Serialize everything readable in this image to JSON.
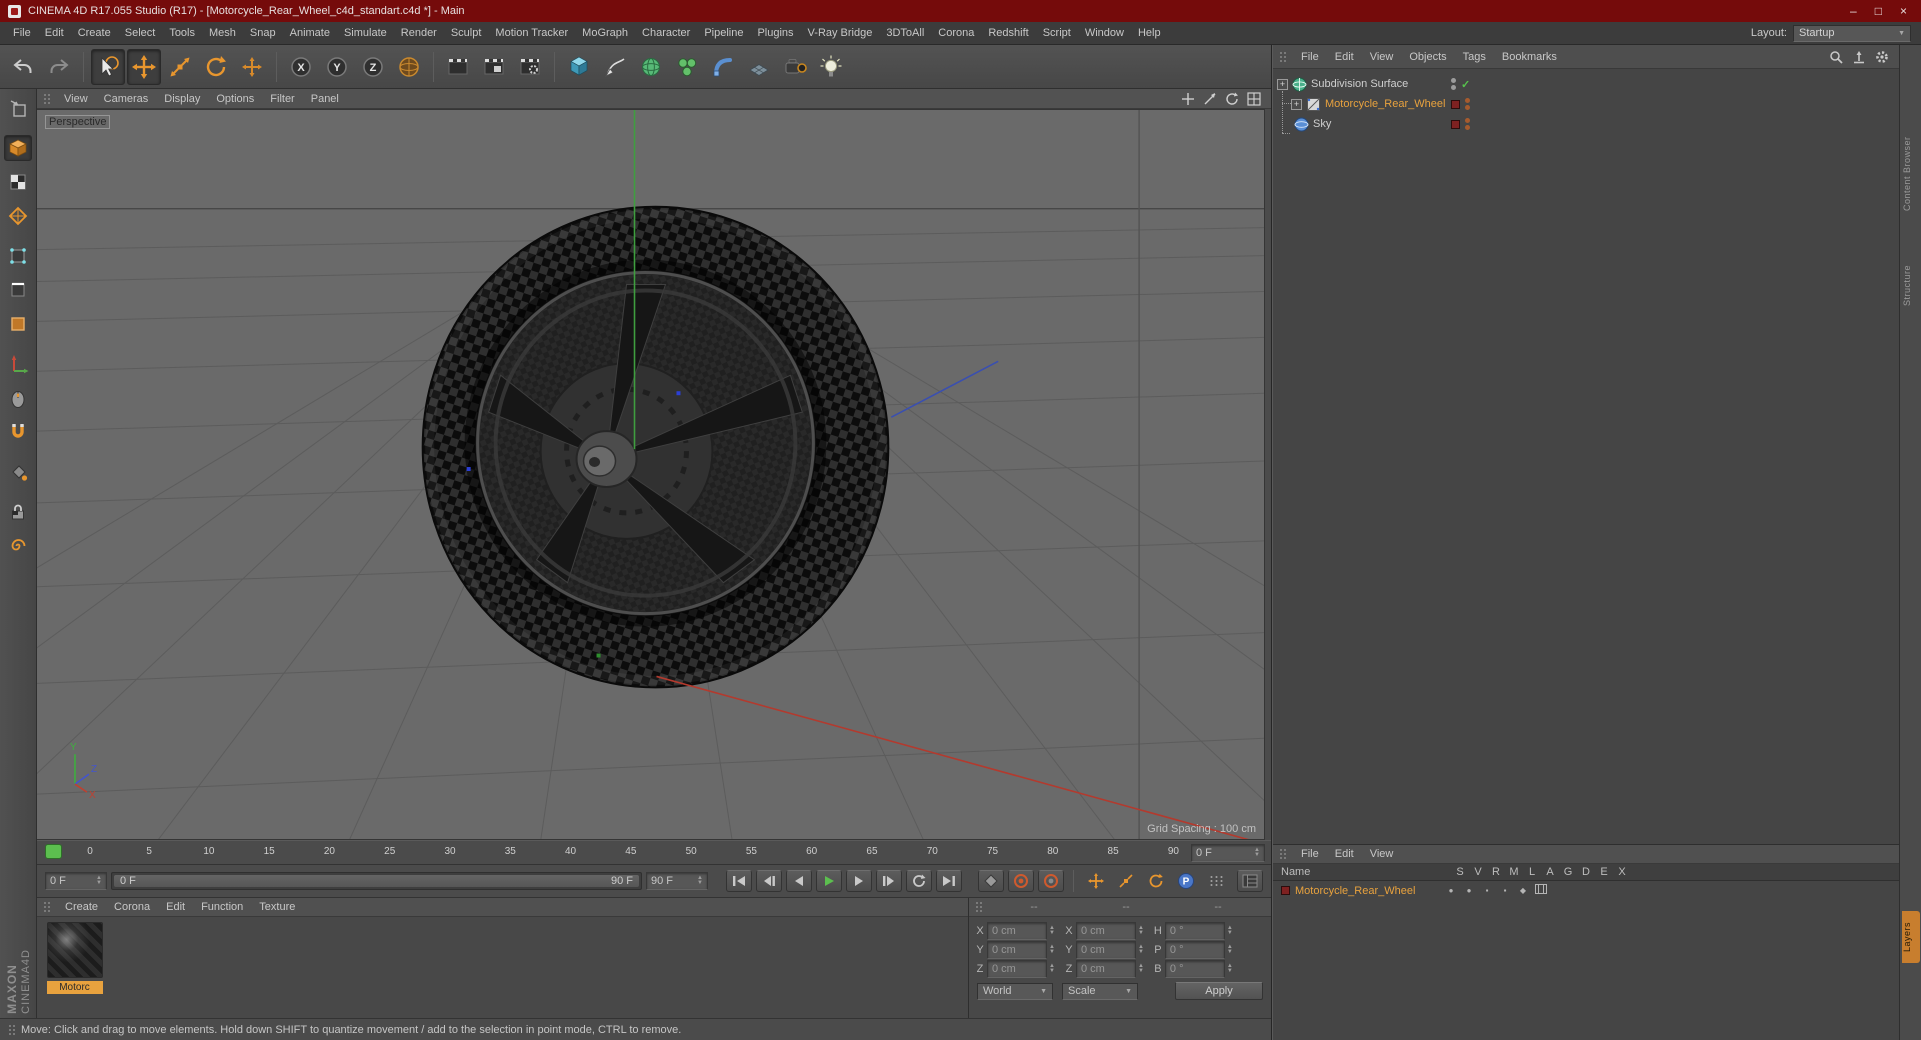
{
  "window": {
    "title": "CINEMA 4D R17.055 Studio (R17) - [Motorcycle_Rear_Wheel_c4d_standart.c4d *] - Main",
    "controls": {
      "min": "–",
      "max": "□",
      "close": "×"
    }
  },
  "menubar": {
    "items": [
      "File",
      "Edit",
      "Create",
      "Select",
      "Tools",
      "Mesh",
      "Snap",
      "Animate",
      "Simulate",
      "Render",
      "Sculpt",
      "Motion Tracker",
      "MoGraph",
      "Character",
      "Pipeline",
      "Plugins",
      "V-Ray Bridge",
      "3DToAll",
      "Corona",
      "Redshift",
      "Script",
      "Window",
      "Help"
    ],
    "layout_label": "Layout:",
    "layout_value": "Startup"
  },
  "viewport": {
    "menu": [
      "View",
      "Cameras",
      "Display",
      "Options",
      "Filter",
      "Panel"
    ],
    "camera_label": "Perspective",
    "grid_spacing": "Grid Spacing : 100 cm"
  },
  "object_manager": {
    "menu": [
      "File",
      "Edit",
      "View",
      "Objects",
      "Tags",
      "Bookmarks"
    ],
    "objects": [
      {
        "name": "Subdivision Surface"
      },
      {
        "name": "Motorcycle_Rear_Wheel"
      },
      {
        "name": "Sky"
      }
    ]
  },
  "side_tabs": [
    "Content Browser",
    "Structure",
    "Layers"
  ],
  "timeline": {
    "ticks": [
      "0",
      "5",
      "10",
      "15",
      "20",
      "25",
      "30",
      "35",
      "40",
      "45",
      "50",
      "55",
      "60",
      "65",
      "70",
      "75",
      "80",
      "85",
      "90"
    ],
    "mini": "0 F",
    "current": "0 F",
    "range_start": "0 F",
    "range_end": "90 F",
    "end": "90 F"
  },
  "materials": {
    "menu": [
      "Create",
      "Corona",
      "Edit",
      "Function",
      "Texture"
    ],
    "items": [
      {
        "name": "Motorc"
      }
    ]
  },
  "coordinates": {
    "headers": [
      "--",
      "--",
      "--"
    ],
    "pos_labels": [
      "X",
      "Y",
      "Z"
    ],
    "pos_values": [
      "0 cm",
      "0 cm",
      "0 cm"
    ],
    "size_labels": [
      "X",
      "Y",
      "Z"
    ],
    "size_values": [
      "0 cm",
      "0 cm",
      "0 cm"
    ],
    "rot_labels": [
      "H",
      "P",
      "B"
    ],
    "rot_values": [
      "0 °",
      "0 °",
      "0 °"
    ],
    "world": "World",
    "scale": "Scale",
    "apply": "Apply"
  },
  "layer_manager": {
    "menu": [
      "File",
      "Edit",
      "View"
    ],
    "name_header": "Name",
    "columns": [
      "S",
      "V",
      "R",
      "M",
      "L",
      "A",
      "G",
      "D",
      "E",
      "X"
    ],
    "rows": [
      {
        "name": "Motorcycle_Rear_Wheel"
      }
    ]
  },
  "status": {
    "text": "Move: Click and drag to move elements. Hold down SHIFT to quantize movement / add to the selection in point mode, CTRL to remove."
  },
  "branding": {
    "line1": "MAXON",
    "line2": "CINEMA4D"
  },
  "colors": {
    "accent": "#e8962e",
    "titlebar": "#750b0b",
    "selection": "#e8a23e",
    "play": "#5cbf4f"
  }
}
